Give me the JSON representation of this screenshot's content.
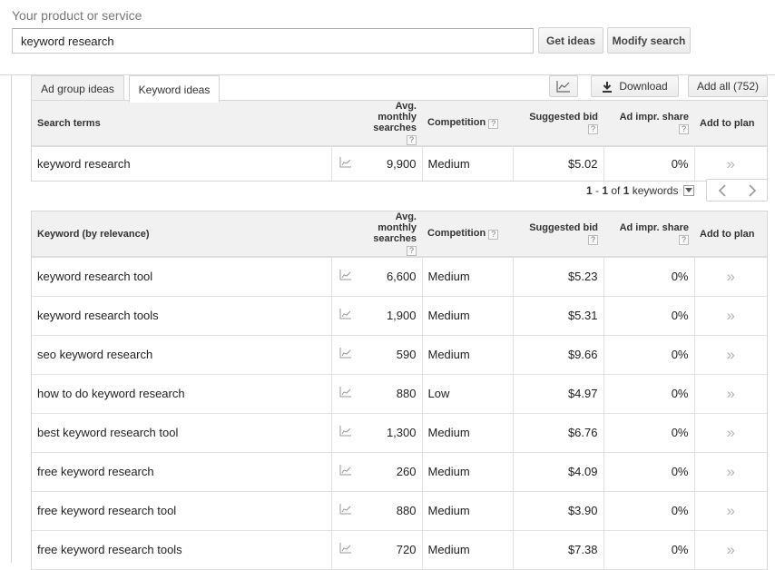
{
  "search": {
    "label": "Your product or service",
    "value": "keyword research",
    "get_ideas_label": "Get ideas",
    "modify_search_label": "Modify search"
  },
  "tabs": [
    {
      "label": "Ad group ideas",
      "active": false
    },
    {
      "label": "Keyword ideas",
      "active": true
    }
  ],
  "toolbar": {
    "chart_icon": "line-chart-icon",
    "download_label": "Download",
    "add_all_label": "Add all (752)"
  },
  "search_terms_table": {
    "headers": {
      "term": "Search terms",
      "avg_line1": "Avg. monthly",
      "avg_line2": "searches",
      "competition": "Competition",
      "bid_line1": "Suggested bid",
      "share_line1": "Ad impr. share",
      "add_to_plan": "Add to plan",
      "help": "?"
    },
    "rows": [
      {
        "term": "keyword research",
        "searches": "9,900",
        "competition": "Medium",
        "bid": "$5.02",
        "share": "0%",
        "add": "»"
      }
    ]
  },
  "pager": {
    "from": "1",
    "sep": " - ",
    "to": "1",
    "of": " of ",
    "total": "1",
    "unit": " keywords"
  },
  "keyword_table": {
    "headers": {
      "term": "Keyword (by relevance)",
      "avg_line1": "Avg. monthly",
      "avg_line2": "searches",
      "competition": "Competition",
      "bid_line1": "Suggested bid",
      "share_line1": "Ad impr. share",
      "add_to_plan": "Add to plan",
      "help": "?"
    },
    "rows": [
      {
        "term": "keyword research tool",
        "searches": "6,600",
        "competition": "Medium",
        "bid": "$5.23",
        "share": "0%",
        "add": "»"
      },
      {
        "term": "keyword research tools",
        "searches": "1,900",
        "competition": "Medium",
        "bid": "$5.31",
        "share": "0%",
        "add": "»"
      },
      {
        "term": "seo keyword research",
        "searches": "590",
        "competition": "Medium",
        "bid": "$9.66",
        "share": "0%",
        "add": "»"
      },
      {
        "term": "how to do keyword research",
        "searches": "880",
        "competition": "Low",
        "bid": "$4.97",
        "share": "0%",
        "add": "»"
      },
      {
        "term": "best keyword research tool",
        "searches": "1,300",
        "competition": "Medium",
        "bid": "$6.76",
        "share": "0%",
        "add": "»"
      },
      {
        "term": "free keyword research",
        "searches": "260",
        "competition": "Medium",
        "bid": "$4.09",
        "share": "0%",
        "add": "»"
      },
      {
        "term": "free keyword research tool",
        "searches": "880",
        "competition": "Medium",
        "bid": "$3.90",
        "share": "0%",
        "add": "»"
      },
      {
        "term": "free keyword research tools",
        "searches": "720",
        "competition": "Medium",
        "bid": "$7.38",
        "share": "0%",
        "add": "»"
      }
    ]
  },
  "colors": {
    "border": "#d6d6d6",
    "header_bg": "#f1f1f1",
    "muted_text": "#777777"
  }
}
